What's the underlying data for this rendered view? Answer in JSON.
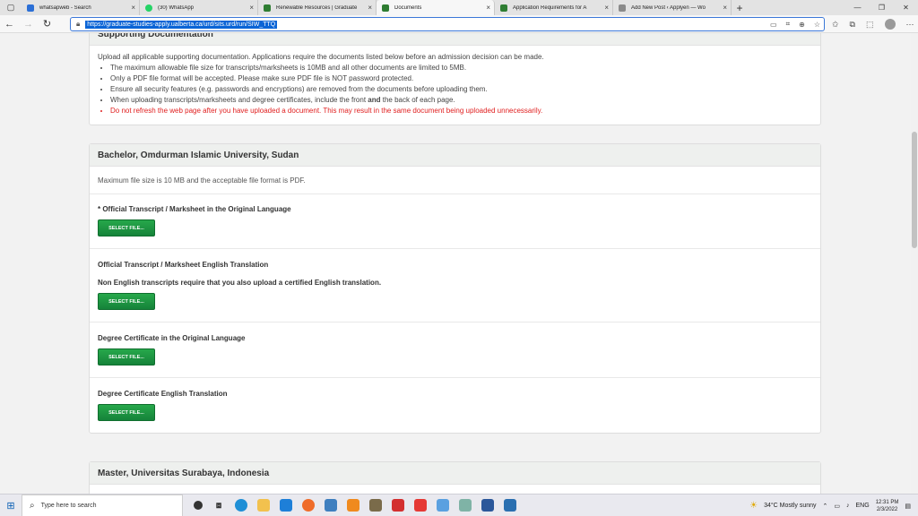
{
  "browser": {
    "tabs": [
      {
        "label": "whatsapweb - Search",
        "color": "#2b6fd6",
        "active": false
      },
      {
        "label": "(30) WhatsApp",
        "color": "#25d366",
        "active": false
      },
      {
        "label": "Renewable Resources | Graduate",
        "color": "#2e7d32",
        "active": false
      },
      {
        "label": "Documents",
        "color": "#2e7d32",
        "active": true
      },
      {
        "label": "Application Requirements for A",
        "color": "#2e7d32",
        "active": false
      },
      {
        "label": "Add New Post ‹ Applyen — Wo",
        "color": "#8a8a8a",
        "active": false
      }
    ],
    "tab_close": "×",
    "new_tab": "+",
    "url": "https://graduate-studies-apply.ualberta.ca/urd/sits.urd/run/SIW_TTQ"
  },
  "supporting": {
    "title": "Supporting Documentation",
    "intro": "Upload all applicable supporting documentation. Applications require the documents listed below before an admission decision can be made.",
    "bullets": [
      "The maximum allowable file size for transcripts/marksheets is 10MB and all other documents are limited to 5MB.",
      "Only a PDF file format will be accepted. Please make sure PDF file is NOT password protected.",
      "Ensure all security features (e.g. passwords and encryptions) are removed from the documents before uploading them."
    ],
    "bullet4_pre": "When uploading transcripts/marksheets and degree certificates, include the front ",
    "bullet4_bold": "and",
    "bullet4_post": " the back of each page.",
    "warning": "Do not refresh the web page after you have uploaded a document. This may result in the same document being uploaded unnecessarily."
  },
  "bachelor": {
    "title": "Bachelor, Omdurman Islamic University, Sudan",
    "note": "Maximum file size is 10 MB and the acceptable file format is PDF.",
    "docs": [
      {
        "title": "* Official Transcript / Marksheet in the Original Language",
        "sub": "",
        "button": "SELECT FILE..."
      },
      {
        "title": "Official Transcript / Marksheet English Translation",
        "sub": "Non English transcripts require that you also upload a certified English translation.",
        "button": "SELECT FILE..."
      },
      {
        "title": "Degree Certificate in the Original Language",
        "sub": "",
        "button": "SELECT FILE..."
      },
      {
        "title": "Degree Certificate English Translation",
        "sub": "",
        "button": "SELECT FILE..."
      }
    ]
  },
  "master": {
    "title": "Master, Universitas Surabaya, Indonesia"
  },
  "taskbar": {
    "search_placeholder": "Type here to search",
    "weather": "34°C  Mostly sunny",
    "lang": "ENG",
    "time": "12:31 PM",
    "date": "2/3/2022"
  }
}
